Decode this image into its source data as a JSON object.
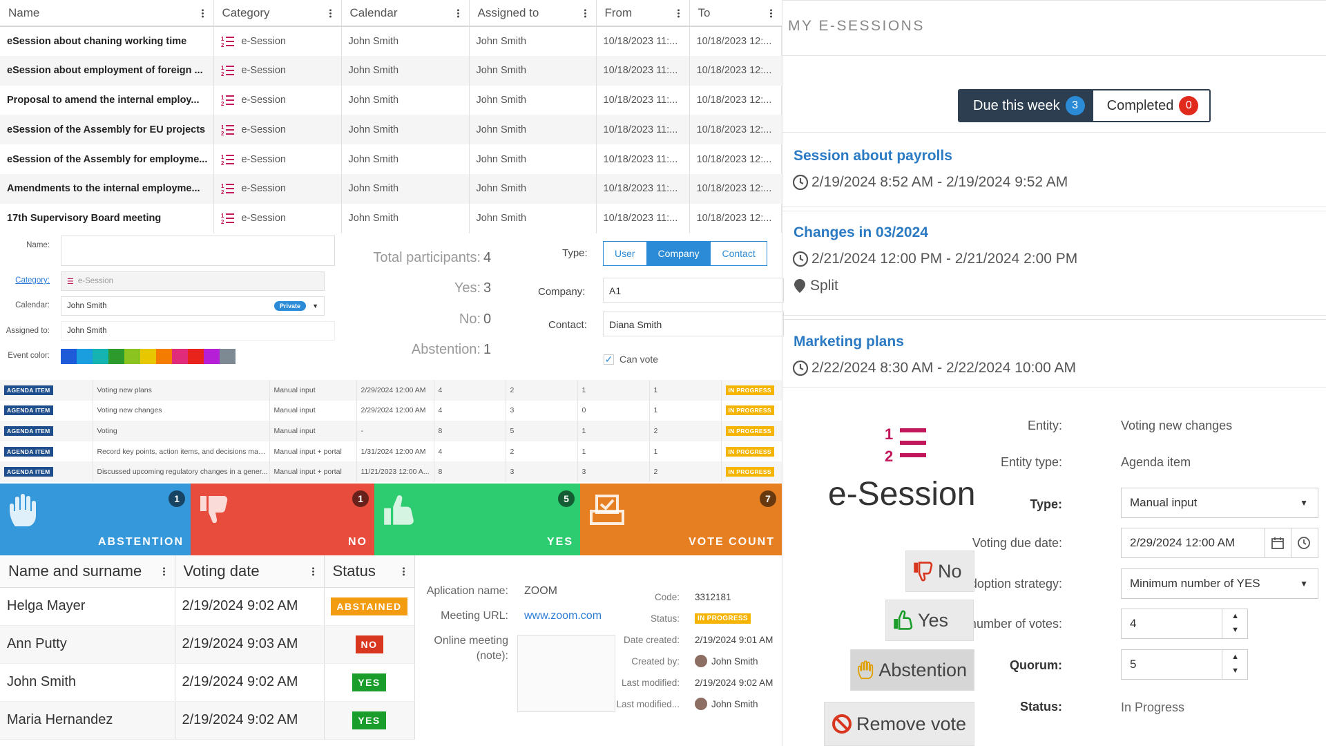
{
  "events_table": {
    "headers": [
      "Name",
      "Category",
      "Calendar",
      "Assigned to",
      "From",
      "To"
    ],
    "rows": [
      {
        "name": "eSession about chaning working time",
        "category": "e-Session",
        "calendar": "John Smith",
        "assigned": "John Smith",
        "from": "10/18/2023 11:...",
        "to": "10/18/2023 12:..."
      },
      {
        "name": "eSession about employment of foreign ...",
        "category": "e-Session",
        "calendar": "John Smith",
        "assigned": "John Smith",
        "from": "10/18/2023 11:...",
        "to": "10/18/2023 12:..."
      },
      {
        "name": "Proposal to amend the internal employ...",
        "category": "e-Session",
        "calendar": "John Smith",
        "assigned": "John Smith",
        "from": "10/18/2023 11:...",
        "to": "10/18/2023 12:..."
      },
      {
        "name": "eSession of the Assembly for EU projects",
        "category": "e-Session",
        "calendar": "John Smith",
        "assigned": "John Smith",
        "from": "10/18/2023 11:...",
        "to": "10/18/2023 12:..."
      },
      {
        "name": "eSession of the Assembly for employme...",
        "category": "e-Session",
        "calendar": "John Smith",
        "assigned": "John Smith",
        "from": "10/18/2023 11:...",
        "to": "10/18/2023 12:..."
      },
      {
        "name": "Amendments to the internal employme...",
        "category": "e-Session",
        "calendar": "John Smith",
        "assigned": "John Smith",
        "from": "10/18/2023 11:...",
        "to": "10/18/2023 12:..."
      },
      {
        "name": "17th Supervisory Board meeting",
        "category": "e-Session",
        "calendar": "John Smith",
        "assigned": "John Smith",
        "from": "10/18/2023 11:...",
        "to": "10/18/2023 12:..."
      }
    ]
  },
  "event_form": {
    "name_label": "Name:",
    "name_value": "",
    "category_label": "Category:",
    "category_value": "e-Session",
    "calendar_label": "Calendar:",
    "calendar_value": "John Smith",
    "calendar_badge": "Private",
    "assigned_label": "Assigned to:",
    "assigned_value": "John Smith",
    "color_label": "Event color:",
    "colors": [
      "#1e5bd8",
      "#1a9ee0",
      "#16b3b3",
      "#2d9a2d",
      "#8bc320",
      "#e6c700",
      "#f47c00",
      "#e02a7a",
      "#e8231c",
      "#b51fd6",
      "#7d8a94"
    ]
  },
  "stats": {
    "total_label": "Total participants:",
    "total": "4",
    "yes_label": "Yes:",
    "yes": "3",
    "no_label": "No:",
    "no": "0",
    "abst_label": "Abstention:",
    "abst": "1"
  },
  "contact": {
    "type_label": "Type:",
    "types": [
      "User",
      "Company",
      "Contact"
    ],
    "active_type": "Company",
    "company_label": "Company:",
    "company_value": "A1",
    "contact_label": "Contact:",
    "contact_value": "Diana Smith",
    "can_vote": "Can vote"
  },
  "agenda": {
    "rows": [
      {
        "tag": "AGENDA ITEM",
        "title": "Voting new plans",
        "input": "Manual input",
        "date": "2/29/2024 12:00 AM",
        "a": "4",
        "b": "2",
        "c": "1",
        "d": "1",
        "status": "IN PROGRESS"
      },
      {
        "tag": "AGENDA ITEM",
        "title": "Voting new changes",
        "input": "Manual input",
        "date": "2/29/2024 12:00 AM",
        "a": "4",
        "b": "3",
        "c": "0",
        "d": "1",
        "status": "IN PROGRESS"
      },
      {
        "tag": "AGENDA ITEM",
        "title": "Voting",
        "input": "Manual input",
        "date": "-",
        "a": "8",
        "b": "5",
        "c": "1",
        "d": "2",
        "status": "IN PROGRESS"
      },
      {
        "tag": "AGENDA ITEM",
        "title": "Record key points, action items, and decisions made...",
        "input": "Manual input + portal",
        "date": "1/31/2024 12:00 AM",
        "a": "4",
        "b": "2",
        "c": "1",
        "d": "1",
        "status": "IN PROGRESS"
      },
      {
        "tag": "AGENDA ITEM",
        "title": "Discussed upcoming regulatory changes in a gener...",
        "input": "Manual input + portal",
        "date": "11/21/2023 12:00 A...",
        "a": "8",
        "b": "3",
        "c": "3",
        "d": "2",
        "status": "IN PROGRESS"
      }
    ]
  },
  "tiles": [
    {
      "label": "ABSTENTION",
      "count": "1",
      "color": "#3498db"
    },
    {
      "label": "NO",
      "count": "1",
      "color": "#e74c3c"
    },
    {
      "label": "YES",
      "count": "5",
      "color": "#2ecc71"
    },
    {
      "label": "VOTE COUNT",
      "count": "7",
      "color": "#e67e22"
    }
  ],
  "voters": {
    "headers": [
      "Name and surname",
      "Voting date",
      "Status"
    ],
    "rows": [
      {
        "name": "Helga Mayer",
        "date": "2/19/2024 9:02 AM",
        "status": "ABSTAINED",
        "color": "#f39c12"
      },
      {
        "name": "Ann Putty",
        "date": "2/19/2024 9:03 AM",
        "status": "NO",
        "color": "#d9361f"
      },
      {
        "name": "John Smith",
        "date": "2/19/2024 9:02 AM",
        "status": "YES",
        "color": "#1a9d2b"
      },
      {
        "name": "Maria Hernandez",
        "date": "2/19/2024 9:02 AM",
        "status": "YES",
        "color": "#1a9d2b"
      }
    ]
  },
  "meeting": {
    "app_label": "Aplication name:",
    "app_value": "ZOOM",
    "url_label": "Meeting URL:",
    "url_value": "www.zoom.com",
    "note_label1": "Online meeting",
    "note_label2": "(note):",
    "code_label": "Code:",
    "code_value": "3312181",
    "status_label": "Status:",
    "status_value": "IN PROGRESS",
    "created_label": "Date created:",
    "created_value": "2/19/2024 9:01 AM",
    "createdby_label": "Created by:",
    "createdby_value": "John Smith",
    "modified_label": "Last modified:",
    "modified_value": "2/19/2024 9:02 AM",
    "modifiedby_label": "Last modified...",
    "modifiedby_value": "John Smith"
  },
  "my_sessions": {
    "title": "MY E-SESSIONS",
    "tab_due": "Due this week",
    "tab_due_count": "3",
    "tab_completed": "Completed",
    "tab_completed_count": "0",
    "sessions": [
      {
        "title": "Session about payrolls",
        "time": "2/19/2024 8:52 AM - 2/19/2024 9:52 AM",
        "location": ""
      },
      {
        "title": "Changes in 03/2024",
        "time": "2/21/2024 12:00 PM - 2/21/2024 2:00 PM",
        "location": "Split"
      },
      {
        "title": "Marketing plans",
        "time": "2/22/2024 8:30 AM - 2/22/2024 10:00 AM",
        "location": ""
      }
    ]
  },
  "vote_form": {
    "logo_text": "e-Session",
    "entity_label": "Entity:",
    "entity_value": "Voting new changes",
    "etype_label": "Entity type:",
    "etype_value": "Agenda item",
    "type_label": "Type:",
    "type_value": "Manual input",
    "due_label": "Voting due date:",
    "due_value": "2/29/2024 12:00 AM",
    "strategy_label": "Adoption strategy:",
    "strategy_value": "Minimum number of YES",
    "minvotes_label": "Min. number of votes:",
    "minvotes_value": "4",
    "quorum_label": "Quorum:",
    "quorum_value": "5",
    "status_label": "Status:",
    "status_value": "In Progress",
    "btn_no": "No",
    "btn_yes": "Yes",
    "btn_abst": "Abstention",
    "btn_remove": "Remove vote"
  }
}
